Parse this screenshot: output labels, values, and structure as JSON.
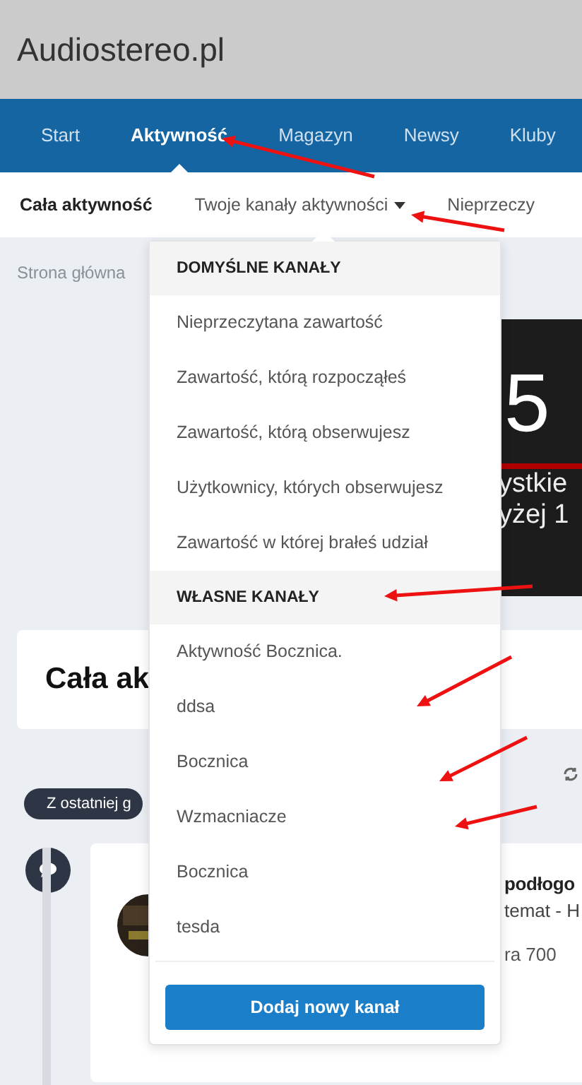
{
  "site_title": "Audiostereo.pl",
  "nav": {
    "tabs": [
      {
        "label": "Start",
        "selected": false
      },
      {
        "label": "Aktywność",
        "selected": true
      },
      {
        "label": "Magazyn",
        "selected": false
      },
      {
        "label": "Newsy",
        "selected": false
      },
      {
        "label": "Kluby",
        "selected": false
      }
    ]
  },
  "subnav": {
    "items": [
      {
        "label": "Cała aktywność",
        "selected": true,
        "kind": "link"
      },
      {
        "label": "Twoje kanały aktywności",
        "selected": false,
        "kind": "menu"
      },
      {
        "label": "Nieprzeczy",
        "selected": false,
        "kind": "link"
      }
    ]
  },
  "breadcrumb": "Strona główna",
  "banner": {
    "number": "5",
    "line_1": "ystkie",
    "line_2": "yżej 1"
  },
  "page_title": "Cała ak",
  "filter_pill": "Z ostatniej g",
  "feed_item": {
    "title": "podłogo",
    "subtitle": "temat - H",
    "snippet": "ra 700"
  },
  "dropdown": {
    "sections": [
      {
        "heading": "DOMYŚLNE KANAŁY",
        "items": [
          "Nieprzeczytana zawartość",
          "Zawartość, którą rozpocząłeś",
          "Zawartość, którą obserwujesz",
          "Użytkownicy, których obserwujesz",
          "Zawartość w której brałeś udział"
        ]
      },
      {
        "heading": "WŁASNE KANAŁY",
        "items": [
          "Aktywność Bocznica.",
          "ddsa",
          "Bocznica",
          "Wzmacniacze",
          "Bocznica",
          "tesda"
        ]
      }
    ],
    "button": "Dodaj nowy kanał"
  }
}
